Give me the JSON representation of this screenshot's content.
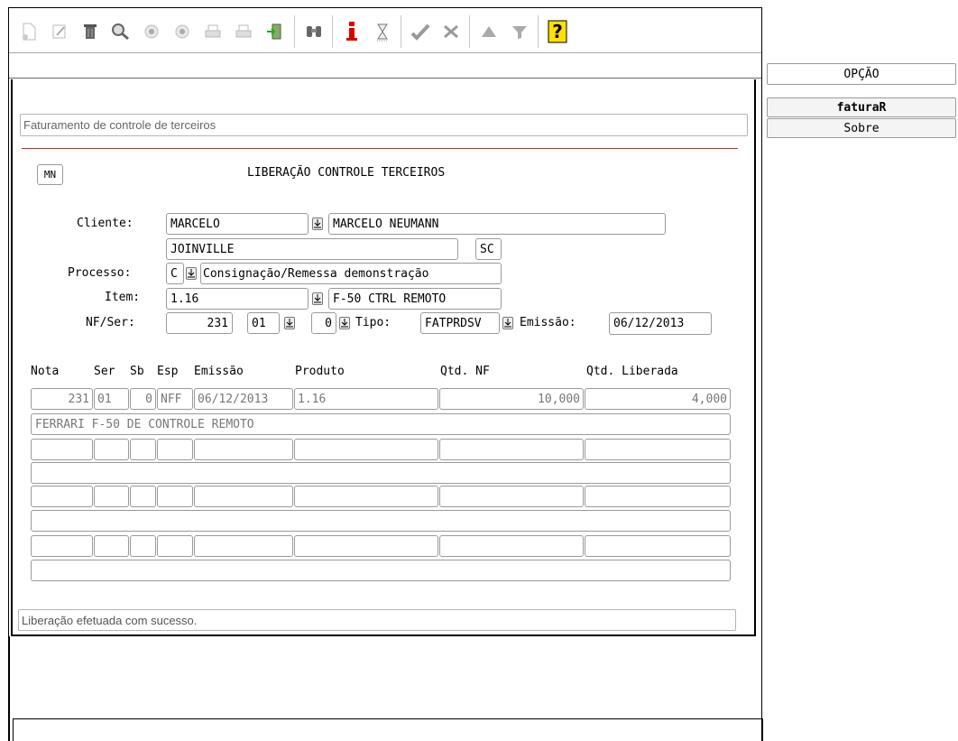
{
  "toolbar": {
    "icons": [
      "new-doc-icon",
      "edit-icon",
      "trash-icon",
      "search-icon",
      "prev-icon",
      "next-icon",
      "print-icon",
      "print-preview-icon",
      "exit-icon",
      "binoculars-icon",
      "info-icon",
      "hourglass-icon",
      "check-icon",
      "cancel-icon",
      "triangle-up-icon",
      "filter-icon",
      "help-icon"
    ]
  },
  "menu": {
    "option_header": "OPÇÃO",
    "items": [
      "faturaR",
      "Sobre"
    ]
  },
  "form": {
    "description": "Faturamento de controle de terceiros",
    "mn_button": "MN",
    "title": "LIBERAÇÃO CONTROLE TERCEIROS",
    "cliente_label": "Cliente:",
    "cliente_code": "MARCELO",
    "cliente_name": "MARCELO NEUMANN",
    "cidade": "JOINVILLE",
    "uf": "SC",
    "processo_label": "Processo:",
    "processo_code": "C",
    "processo_desc": "Consignação/Remessa demonstração",
    "item_label": "Item:",
    "item_code": "1.16",
    "item_desc": "F-50 CTRL REMOTO",
    "nfser_label": "NF/Ser:",
    "nf": "231",
    "serie": "01",
    "sb": "0",
    "tipo_label": "Tipo:",
    "tipo": "FATPRDSV",
    "emissao_label": "Emissão:",
    "emissao": "06/12/2013"
  },
  "grid": {
    "headers": [
      "Nota",
      "Ser",
      "Sb",
      "Esp",
      "Emissão",
      "Produto",
      "Qtd. NF",
      "Qtd. Liberada"
    ],
    "row1": {
      "nota": "231",
      "ser": "01",
      "sb": "0",
      "esp": "NFF",
      "emissao": "06/12/2013",
      "produto": "1.16",
      "qtd_nf": "10,000",
      "qtd_liberada": "4,000",
      "descricao": "FERRARI F-50 DE CONTROLE REMOTO"
    }
  },
  "status": {
    "message": "Liberação efetuada com sucesso."
  }
}
